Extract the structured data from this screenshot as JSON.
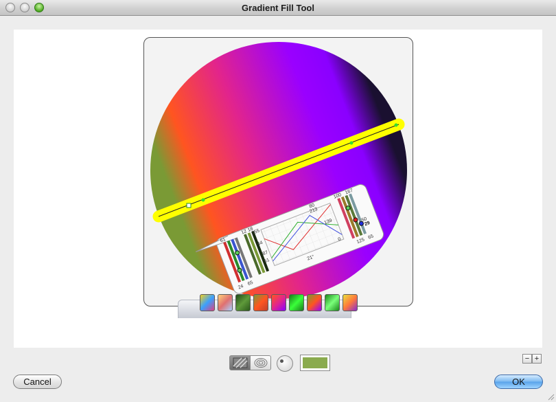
{
  "window": {
    "title": "Gradient Fill Tool"
  },
  "preview": {
    "gradient_stops": [
      "#7a9a35",
      "#ff5520",
      "#e2248c",
      "#9a00ff",
      "#8a00ff",
      "#1a1030"
    ],
    "handle_color": "#ffff00",
    "editor": {
      "left_labels": [
        "61",
        "24",
        "65"
      ],
      "mid_labels": [
        "12",
        "18",
        "255",
        "44",
        "87",
        "51"
      ],
      "right_labels": [
        "100",
        "167",
        "50",
        "29",
        "125",
        "65"
      ],
      "curve_labels": [
        "80",
        "213",
        "139",
        "0"
      ],
      "angle": "21°"
    }
  },
  "presets": {
    "swatches": [
      {
        "name": "preset-1",
        "colors": [
          "#f0d020",
          "#3aa0ff",
          "#e04080"
        ]
      },
      {
        "name": "preset-2",
        "colors": [
          "#ffd27a",
          "#e07070",
          "#a8d0ff"
        ]
      },
      {
        "name": "preset-3",
        "colors": [
          "#1f4a16",
          "#5f9a3a",
          "#2b5a1b"
        ]
      },
      {
        "name": "preset-4",
        "colors": [
          "#7a9a35",
          "#ff5520",
          "#c0402a"
        ]
      },
      {
        "name": "preset-5",
        "colors": [
          "#ff5520",
          "#e2248c",
          "#8a00ff"
        ]
      },
      {
        "name": "preset-6",
        "colors": [
          "#1b7a1b",
          "#39ff39",
          "#1b7a1b"
        ]
      },
      {
        "name": "preset-7",
        "colors": [
          "#7a9a35",
          "#ff5520",
          "#9a00ff"
        ]
      },
      {
        "name": "preset-8",
        "colors": [
          "#1b8a1b",
          "#7aff7a",
          "#1b8a1b"
        ]
      },
      {
        "name": "preset-9",
        "colors": [
          "#e8e040",
          "#ff7a3a",
          "#8a2bd0"
        ]
      }
    ]
  },
  "controls": {
    "fill_color": "#8aab4e",
    "zoom_out": "−",
    "zoom_in": "+"
  },
  "buttons": {
    "cancel": "Cancel",
    "ok": "OK"
  }
}
